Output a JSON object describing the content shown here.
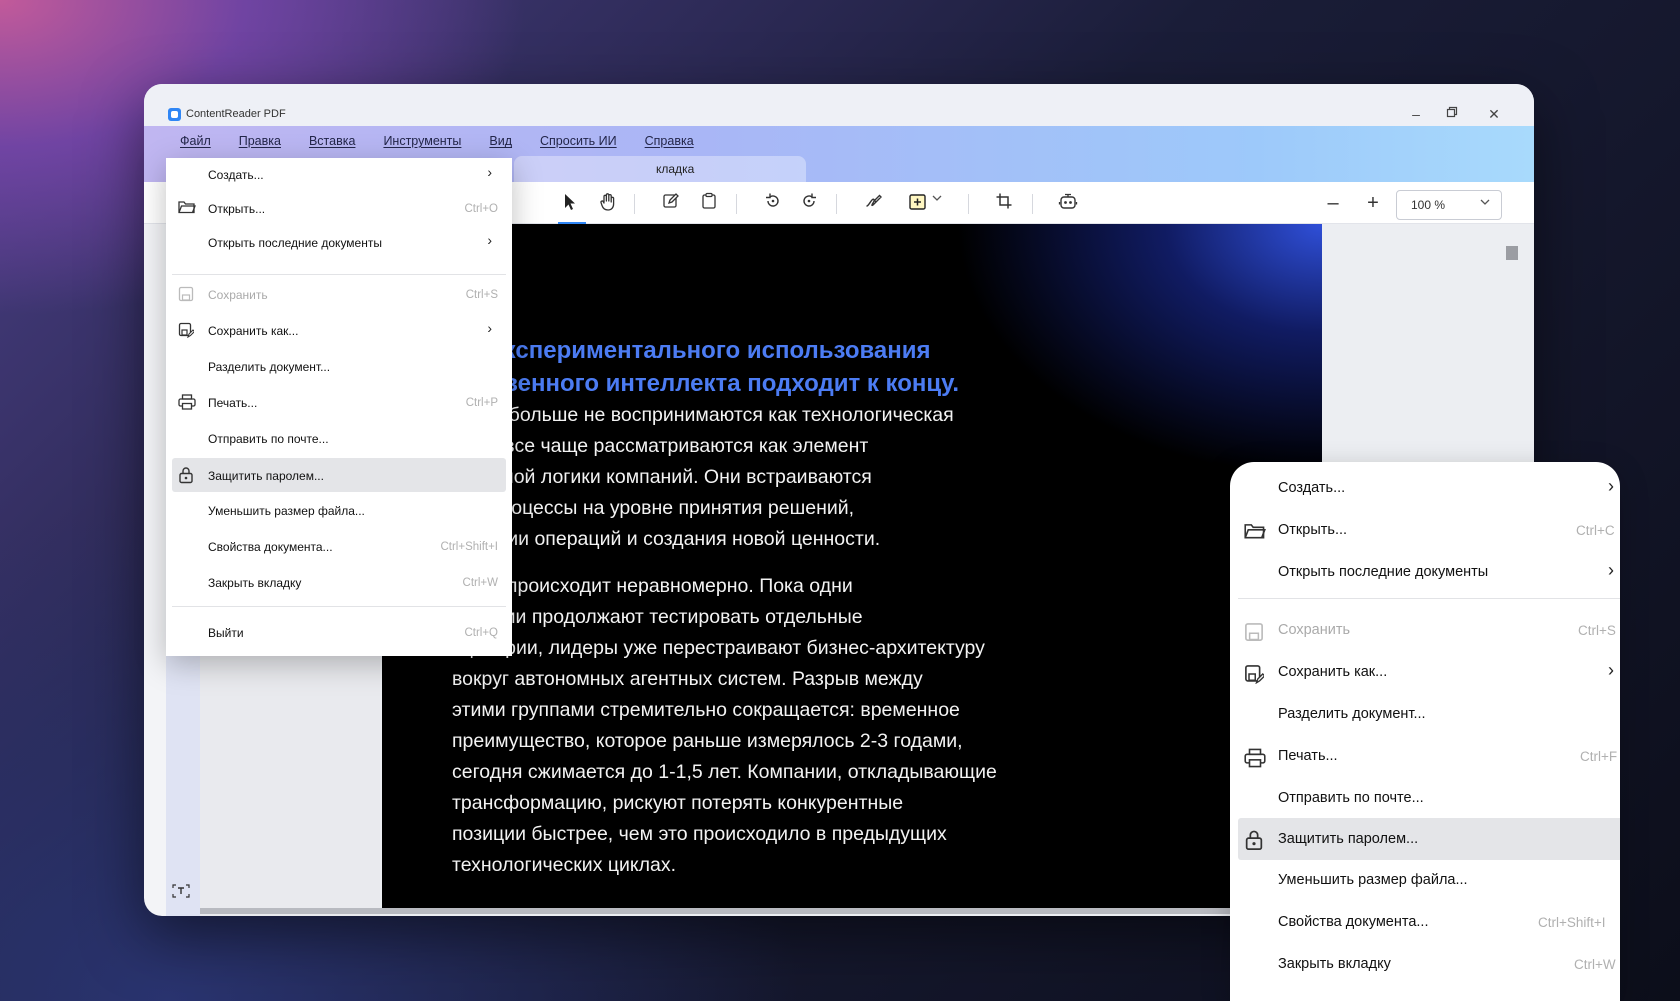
{
  "app": {
    "title": "ContentReader PDF"
  },
  "window_controls": {
    "minimize": "–",
    "maximize": "▫",
    "close": "✕"
  },
  "menubar": [
    "Файл",
    "Правка",
    "Вставка",
    "Инструменты",
    "Вид",
    "Спросить ИИ",
    "Справка"
  ],
  "tab": {
    "label": "кладка"
  },
  "zoom": {
    "value": "100 %"
  },
  "file_menu": [
    {
      "label": "Создать...",
      "shortcut": "",
      "submenu": true
    },
    {
      "label": "Открыть...",
      "shortcut": "Ctrl+O",
      "submenu": false
    },
    {
      "label": "Открыть последние документы",
      "shortcut": "",
      "submenu": true
    },
    {
      "label": "Сохранить",
      "shortcut": "Ctrl+S",
      "submenu": false,
      "disabled": true
    },
    {
      "label": "Сохранить как...",
      "shortcut": "",
      "submenu": true
    },
    {
      "label": "Разделить документ...",
      "shortcut": "",
      "submenu": false
    },
    {
      "label": "Печать...",
      "shortcut": "Ctrl+P",
      "submenu": false
    },
    {
      "label": "Отправить по почте...",
      "shortcut": "",
      "submenu": false
    },
    {
      "label": "Защитить паролем...",
      "shortcut": "",
      "submenu": false,
      "highlighted": true
    },
    {
      "label": "Уменьшить размер файла...",
      "shortcut": "",
      "submenu": false
    },
    {
      "label": "Свойства документа...",
      "shortcut": "Ctrl+Shift+I",
      "submenu": false
    },
    {
      "label": "Закрыть вкладку",
      "shortcut": "Ctrl+W",
      "submenu": false
    },
    {
      "label": "Выйти",
      "shortcut": "Ctrl+Q",
      "submenu": false
    }
  ],
  "zoomed_menu": [
    {
      "label": "Создать...",
      "shortcut": "",
      "submenu": true
    },
    {
      "label": "Открыть...",
      "shortcut": "Ctrl+C",
      "submenu": false
    },
    {
      "label": "Открыть последние документы",
      "shortcut": "",
      "submenu": true
    },
    {
      "label": "Сохранить",
      "shortcut": "Ctrl+S",
      "submenu": false,
      "disabled": true
    },
    {
      "label": "Сохранить как...",
      "shortcut": "",
      "submenu": true
    },
    {
      "label": "Разделить документ...",
      "shortcut": "",
      "submenu": false
    },
    {
      "label": "Печать...",
      "shortcut": "Ctrl+F",
      "submenu": false
    },
    {
      "label": "Отправить по почте...",
      "shortcut": "",
      "submenu": false
    },
    {
      "label": "Защитить паролем...",
      "shortcut": "",
      "submenu": false,
      "highlighted": true
    },
    {
      "label": "Уменьшить размер файла...",
      "shortcut": "",
      "submenu": false
    },
    {
      "label": "Свойства документа...",
      "shortcut": "Ctrl+Shift+I",
      "submenu": false
    },
    {
      "label": "Закрыть вкладку",
      "shortcut": "Ctrl+W",
      "submenu": false
    }
  ],
  "document": {
    "title": "мя экспериментального использования\nусственного интеллекта подходит к концу.",
    "paragraphs": [
      "генты больше не воспринимаются как технологическая\nнка и все чаще рассматриваются как элемент\nурентной логики компаний. Они встраиваются\nнес-процессы на уровне принятия решений,\nмизации операций и создания новой ценности.",
      "сдвиг происходит неравномерно. Пока одни\nнизации продолжают тестировать отдельные\nсценарии, лидеры уже перестраивают бизнес-архитектуру\nвокруг автономных агентных систем. Разрыв между\nэтими группами стремительно сокращается: временное\nпреимущество, которое раньше измерялось 2-3 годами,\nсегодня сжимается до 1-1,5 лет. Компании, откладывающие\nтрансформацию, рискуют потерять конкурентные\nпозиции быстрее, чем это происходило в предыдущих\nтехнологических циклах."
    ]
  }
}
